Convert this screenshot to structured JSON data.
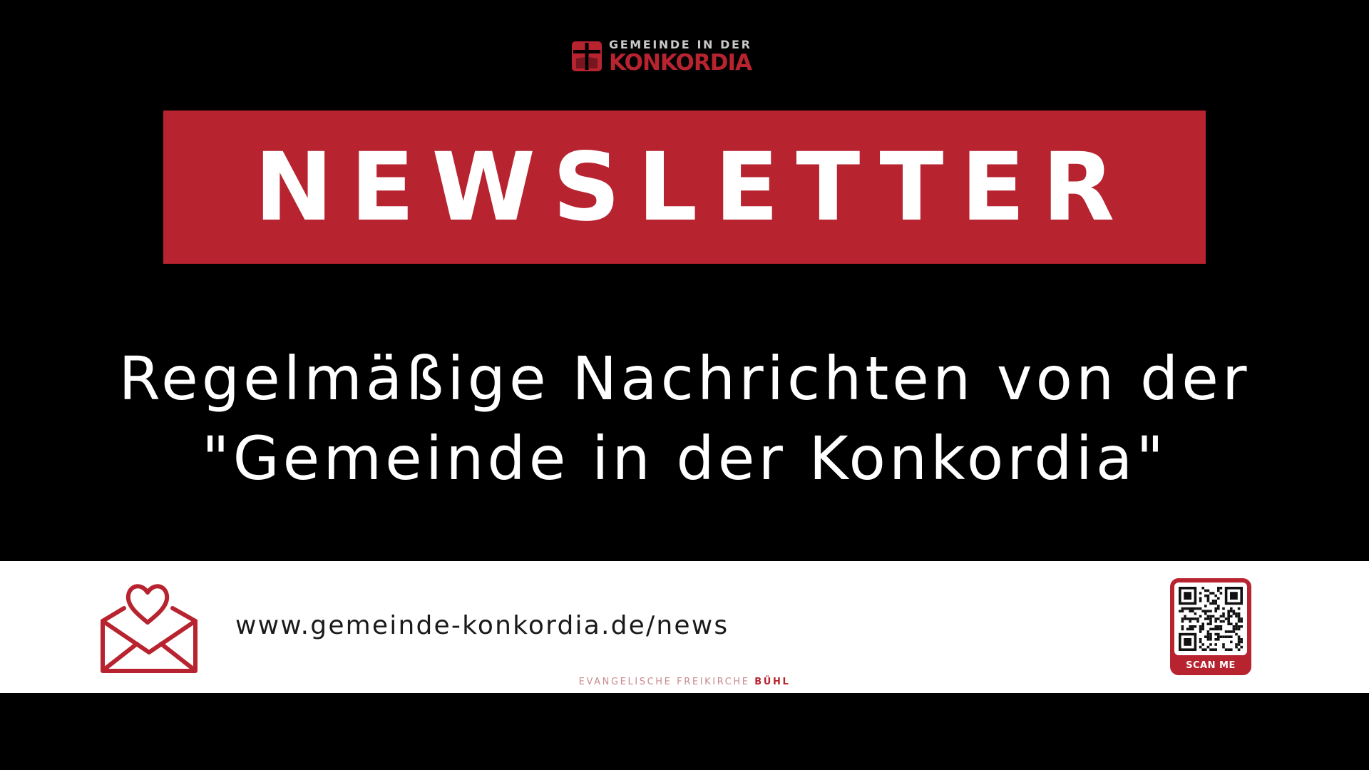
{
  "logo": {
    "top_line": "GEMEINDE IN DER",
    "brand_name": "KONKORDIA",
    "icon": "cross-book-logo-icon",
    "brand_color": "#b82330"
  },
  "headline": {
    "title": "NEWSLETTER",
    "background_color": "#b82330",
    "text_color": "#ffffff"
  },
  "subtitle": {
    "line1": "Regelmäßige Nachrichten von der",
    "line2": "\"Gemeinde in der Konkordia\""
  },
  "footer": {
    "icon": "heart-envelope-icon",
    "url": "www.gemeinde-konkordia.de/news",
    "tagline_prefix": "EVANGELISCHE FREIKIRCHE",
    "tagline_emphasis": "BÜHL",
    "qr": {
      "icon": "qr-code-icon",
      "label": "SCAN ME"
    }
  },
  "colors": {
    "background": "#000000",
    "accent": "#b82330",
    "footer_background": "#ffffff"
  }
}
